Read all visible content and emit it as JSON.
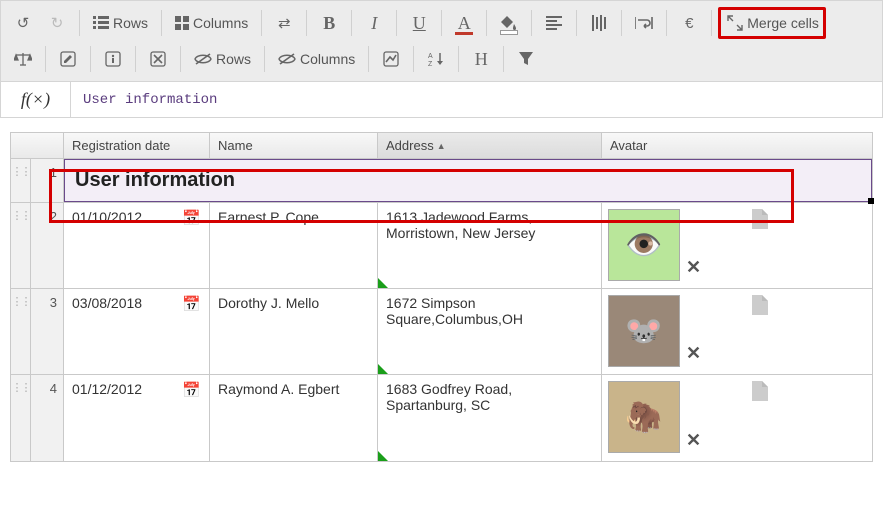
{
  "toolbar": {
    "rows_label": "Rows",
    "columns_label": "Columns",
    "merge_label": "Merge cells",
    "hide_rows_label": "Rows",
    "hide_columns_label": "Columns",
    "currency_symbol": "€",
    "bold_glyph": "B",
    "italic_glyph": "I",
    "underline_glyph": "U",
    "fontcolor_glyph": "A",
    "heading_glyph": "H"
  },
  "formula": {
    "fx_label": "f(×)",
    "value": "User information"
  },
  "columns": {
    "reg": "Registration date",
    "name": "Name",
    "addr": "Address",
    "avatar": "Avatar"
  },
  "merged": {
    "row_num": "1",
    "text": "User information"
  },
  "rows": [
    {
      "num": "2",
      "date": "01/10/2012",
      "name": "Earnest P. Cope",
      "address": "1613 Jadewood Farms, Morristown, New Jersey",
      "avatar_alt": "green-monster"
    },
    {
      "num": "3",
      "date": "03/08/2018",
      "name": "Dorothy J. Mello",
      "address": "1672 Simpson Square,Columbus,OH",
      "avatar_alt": "mouse-character"
    },
    {
      "num": "4",
      "date": "01/12/2012",
      "name": "Raymond A. Egbert",
      "address": "1683 Godfrey Road, Spartanburg, SC",
      "avatar_alt": "mammoth-character"
    }
  ]
}
